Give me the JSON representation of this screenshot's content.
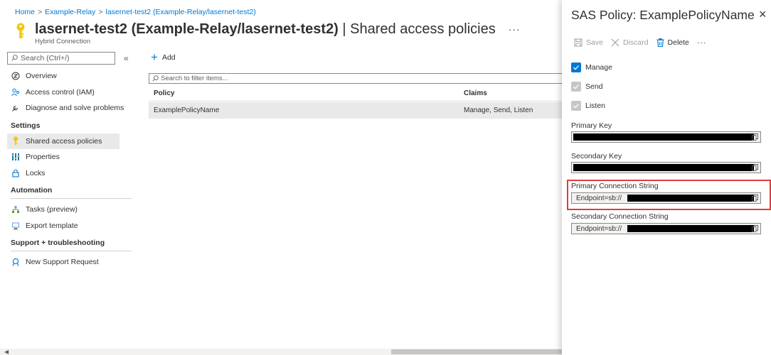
{
  "breadcrumb": {
    "items": [
      "Home",
      "Example-Relay",
      "lasernet-test2 (Example-Relay/lasernet-test2)"
    ],
    "separator": ">"
  },
  "header": {
    "title_bold": "lasernet-test2 (Example-Relay/lasernet-test2)",
    "title_rest": " | Shared access policies",
    "subtitle": "Hybrid Connection",
    "more": "···"
  },
  "sidebar": {
    "search_placeholder": "Search (Ctrl+/)",
    "collapse": "«",
    "items_top": [
      {
        "label": "Overview",
        "icon": "overview-icon"
      },
      {
        "label": "Access control (IAM)",
        "icon": "iam-icon"
      },
      {
        "label": "Diagnose and solve problems",
        "icon": "wrench-icon"
      }
    ],
    "section_settings": "Settings",
    "items_settings": [
      {
        "label": "Shared access policies",
        "icon": "key-icon",
        "active": true
      },
      {
        "label": "Properties",
        "icon": "properties-icon"
      },
      {
        "label": "Locks",
        "icon": "lock-icon"
      }
    ],
    "section_automation": "Automation",
    "items_automation": [
      {
        "label": "Tasks (preview)",
        "icon": "tasks-icon"
      },
      {
        "label": "Export template",
        "icon": "export-icon"
      }
    ],
    "section_support": "Support + troubleshooting",
    "items_support": [
      {
        "label": "New Support Request",
        "icon": "support-icon"
      }
    ]
  },
  "main": {
    "add_label": "Add",
    "filter_placeholder": "Search to filter items...",
    "columns": [
      "Policy",
      "Claims"
    ],
    "rows": [
      {
        "policy": "ExamplePolicyName",
        "claims": "Manage, Send, Listen"
      }
    ]
  },
  "blade": {
    "title": "SAS Policy: ExamplePolicyName",
    "close": "×",
    "toolbar": {
      "save": "Save",
      "discard": "Discard",
      "delete": "Delete",
      "more": "···"
    },
    "checks": [
      {
        "label": "Manage",
        "checked": true,
        "disabled": false
      },
      {
        "label": "Send",
        "checked": true,
        "disabled": true
      },
      {
        "label": "Listen",
        "checked": true,
        "disabled": true
      }
    ],
    "primary_key_label": "Primary Key",
    "secondary_key_label": "Secondary Key",
    "primary_conn_label": "Primary Connection String",
    "primary_conn_value": "Endpoint=sb://",
    "secondary_conn_label": "Secondary Connection String",
    "secondary_conn_value": "Endpoint=sb://"
  },
  "colors": {
    "accent": "#0078d4",
    "highlight": "#e03c3c",
    "key_yellow": "#f2c811"
  }
}
